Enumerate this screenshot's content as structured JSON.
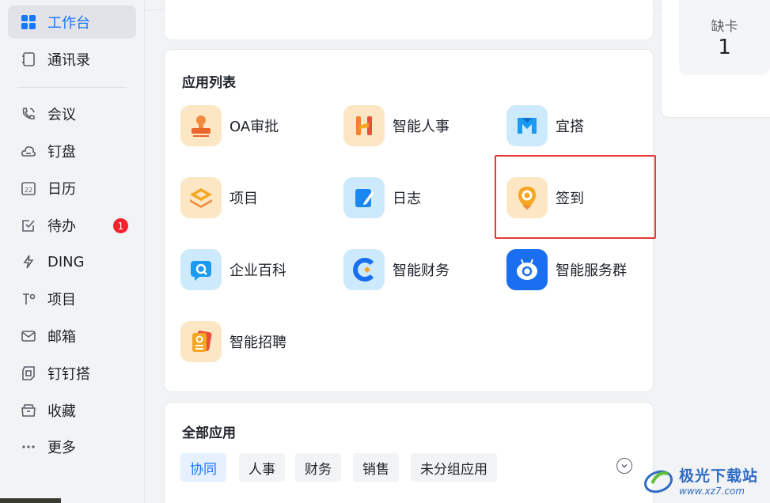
{
  "sidebar": {
    "items": [
      {
        "label": "工作台",
        "icon": "grid-icon",
        "active": true
      },
      {
        "label": "通讯录",
        "icon": "contacts-icon"
      },
      {
        "label": "会议",
        "icon": "phone-icon"
      },
      {
        "label": "钉盘",
        "icon": "cloud-icon"
      },
      {
        "label": "日历",
        "icon": "calendar-icon"
      },
      {
        "label": "待办",
        "icon": "todo-check-icon",
        "badge": "1"
      },
      {
        "label": "DING",
        "icon": "lightning-icon"
      },
      {
        "label": "项目",
        "icon": "project-icon"
      },
      {
        "label": "邮箱",
        "icon": "mail-icon"
      },
      {
        "label": "钉钉搭",
        "icon": "build-icon"
      },
      {
        "label": "收藏",
        "icon": "folder-icon"
      },
      {
        "label": "更多",
        "icon": "more-dots-icon"
      }
    ]
  },
  "side_card": {
    "label": "缺卡",
    "value": "1"
  },
  "apps_section": {
    "title": "应用列表",
    "apps": [
      {
        "label": "OA审批",
        "icon": "stamp-icon"
      },
      {
        "label": "智能人事",
        "icon": "hr-h-icon"
      },
      {
        "label": "宜搭",
        "icon": "yida-icon"
      },
      {
        "label": "项目",
        "icon": "layers-icon"
      },
      {
        "label": "日志",
        "icon": "journal-pen-icon"
      },
      {
        "label": "签到",
        "icon": "location-pin-icon"
      },
      {
        "label": "企业百科",
        "icon": "wiki-search-icon"
      },
      {
        "label": "智能财务",
        "icon": "finance-icon"
      },
      {
        "label": "智能服务群",
        "icon": "robot-icon"
      },
      {
        "label": "智能招聘",
        "icon": "recruit-icon"
      }
    ]
  },
  "all_apps": {
    "title": "全部应用",
    "tags": [
      "协同",
      "人事",
      "财务",
      "销售",
      "未分组应用"
    ]
  },
  "watermark": {
    "title": "极光下载站",
    "url": "www.xz7.com"
  },
  "colors": {
    "accent": "#1677ff",
    "highlight": "#e53935",
    "badge": "#f5222d"
  }
}
